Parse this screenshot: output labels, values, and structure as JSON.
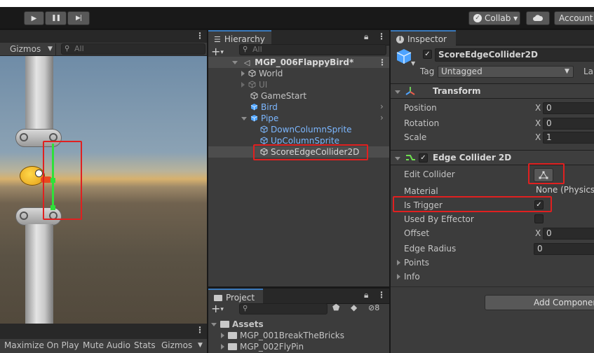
{
  "toolbar": {
    "play_glyph": "▶",
    "pause_glyph": "❚❚",
    "step_glyph": "▶|",
    "collab_label": "Collab ▾",
    "account_label": "Account"
  },
  "scene": {
    "gizmos_label": "Gizmos",
    "search_placeholder": "All"
  },
  "game_bar": {
    "maximize": "Maximize On Play",
    "mute": "Mute Audio",
    "stats": "Stats",
    "gizmos": "Gizmos"
  },
  "hierarchy": {
    "tab_label": "Hierarchy",
    "search_placeholder": "All",
    "scene_name": "MGP_006FlappyBird*",
    "items": [
      {
        "label": "World"
      },
      {
        "label": "UI"
      },
      {
        "label": "GameStart"
      },
      {
        "label": "Bird"
      },
      {
        "label": "Pipe"
      },
      {
        "label": "DownColumnSprite"
      },
      {
        "label": "UpColumnSprite"
      },
      {
        "label": "ScoreEdgeCollider2D"
      }
    ]
  },
  "project": {
    "tab_label": "Project",
    "badge_count": "8",
    "root": "Assets",
    "folders": [
      "MGP_001BreakTheBricks",
      "MGP_002FlyPin"
    ]
  },
  "inspector": {
    "tab_label": "Inspector",
    "object_name": "ScoreEdgeCollider2D",
    "tag_label": "Tag",
    "tag_value": "Untagged",
    "layer_label": "La",
    "transform": {
      "title": "Transform",
      "position_label": "Position",
      "position_x": "0",
      "rotation_label": "Rotation",
      "rotation_x": "0",
      "scale_label": "Scale",
      "scale_x": "1",
      "x_axis": "X"
    },
    "edge_collider": {
      "title": "Edge Collider 2D",
      "edit_collider_label": "Edit Collider",
      "material_label": "Material",
      "material_value": "None (Physics",
      "is_trigger_label": "Is Trigger",
      "is_trigger_checked": true,
      "used_by_effector_label": "Used By Effector",
      "offset_label": "Offset",
      "offset_x": "0",
      "edge_radius_label": "Edge Radius",
      "edge_radius_value": "0",
      "points_label": "Points",
      "info_label": "Info"
    },
    "add_component_label": "Add Componen"
  },
  "colors": {
    "accent": "#3a79bb",
    "highlight_red": "#e02020",
    "prefab_blue": "#7cb7ff",
    "collider_green": "#2fe03a"
  }
}
